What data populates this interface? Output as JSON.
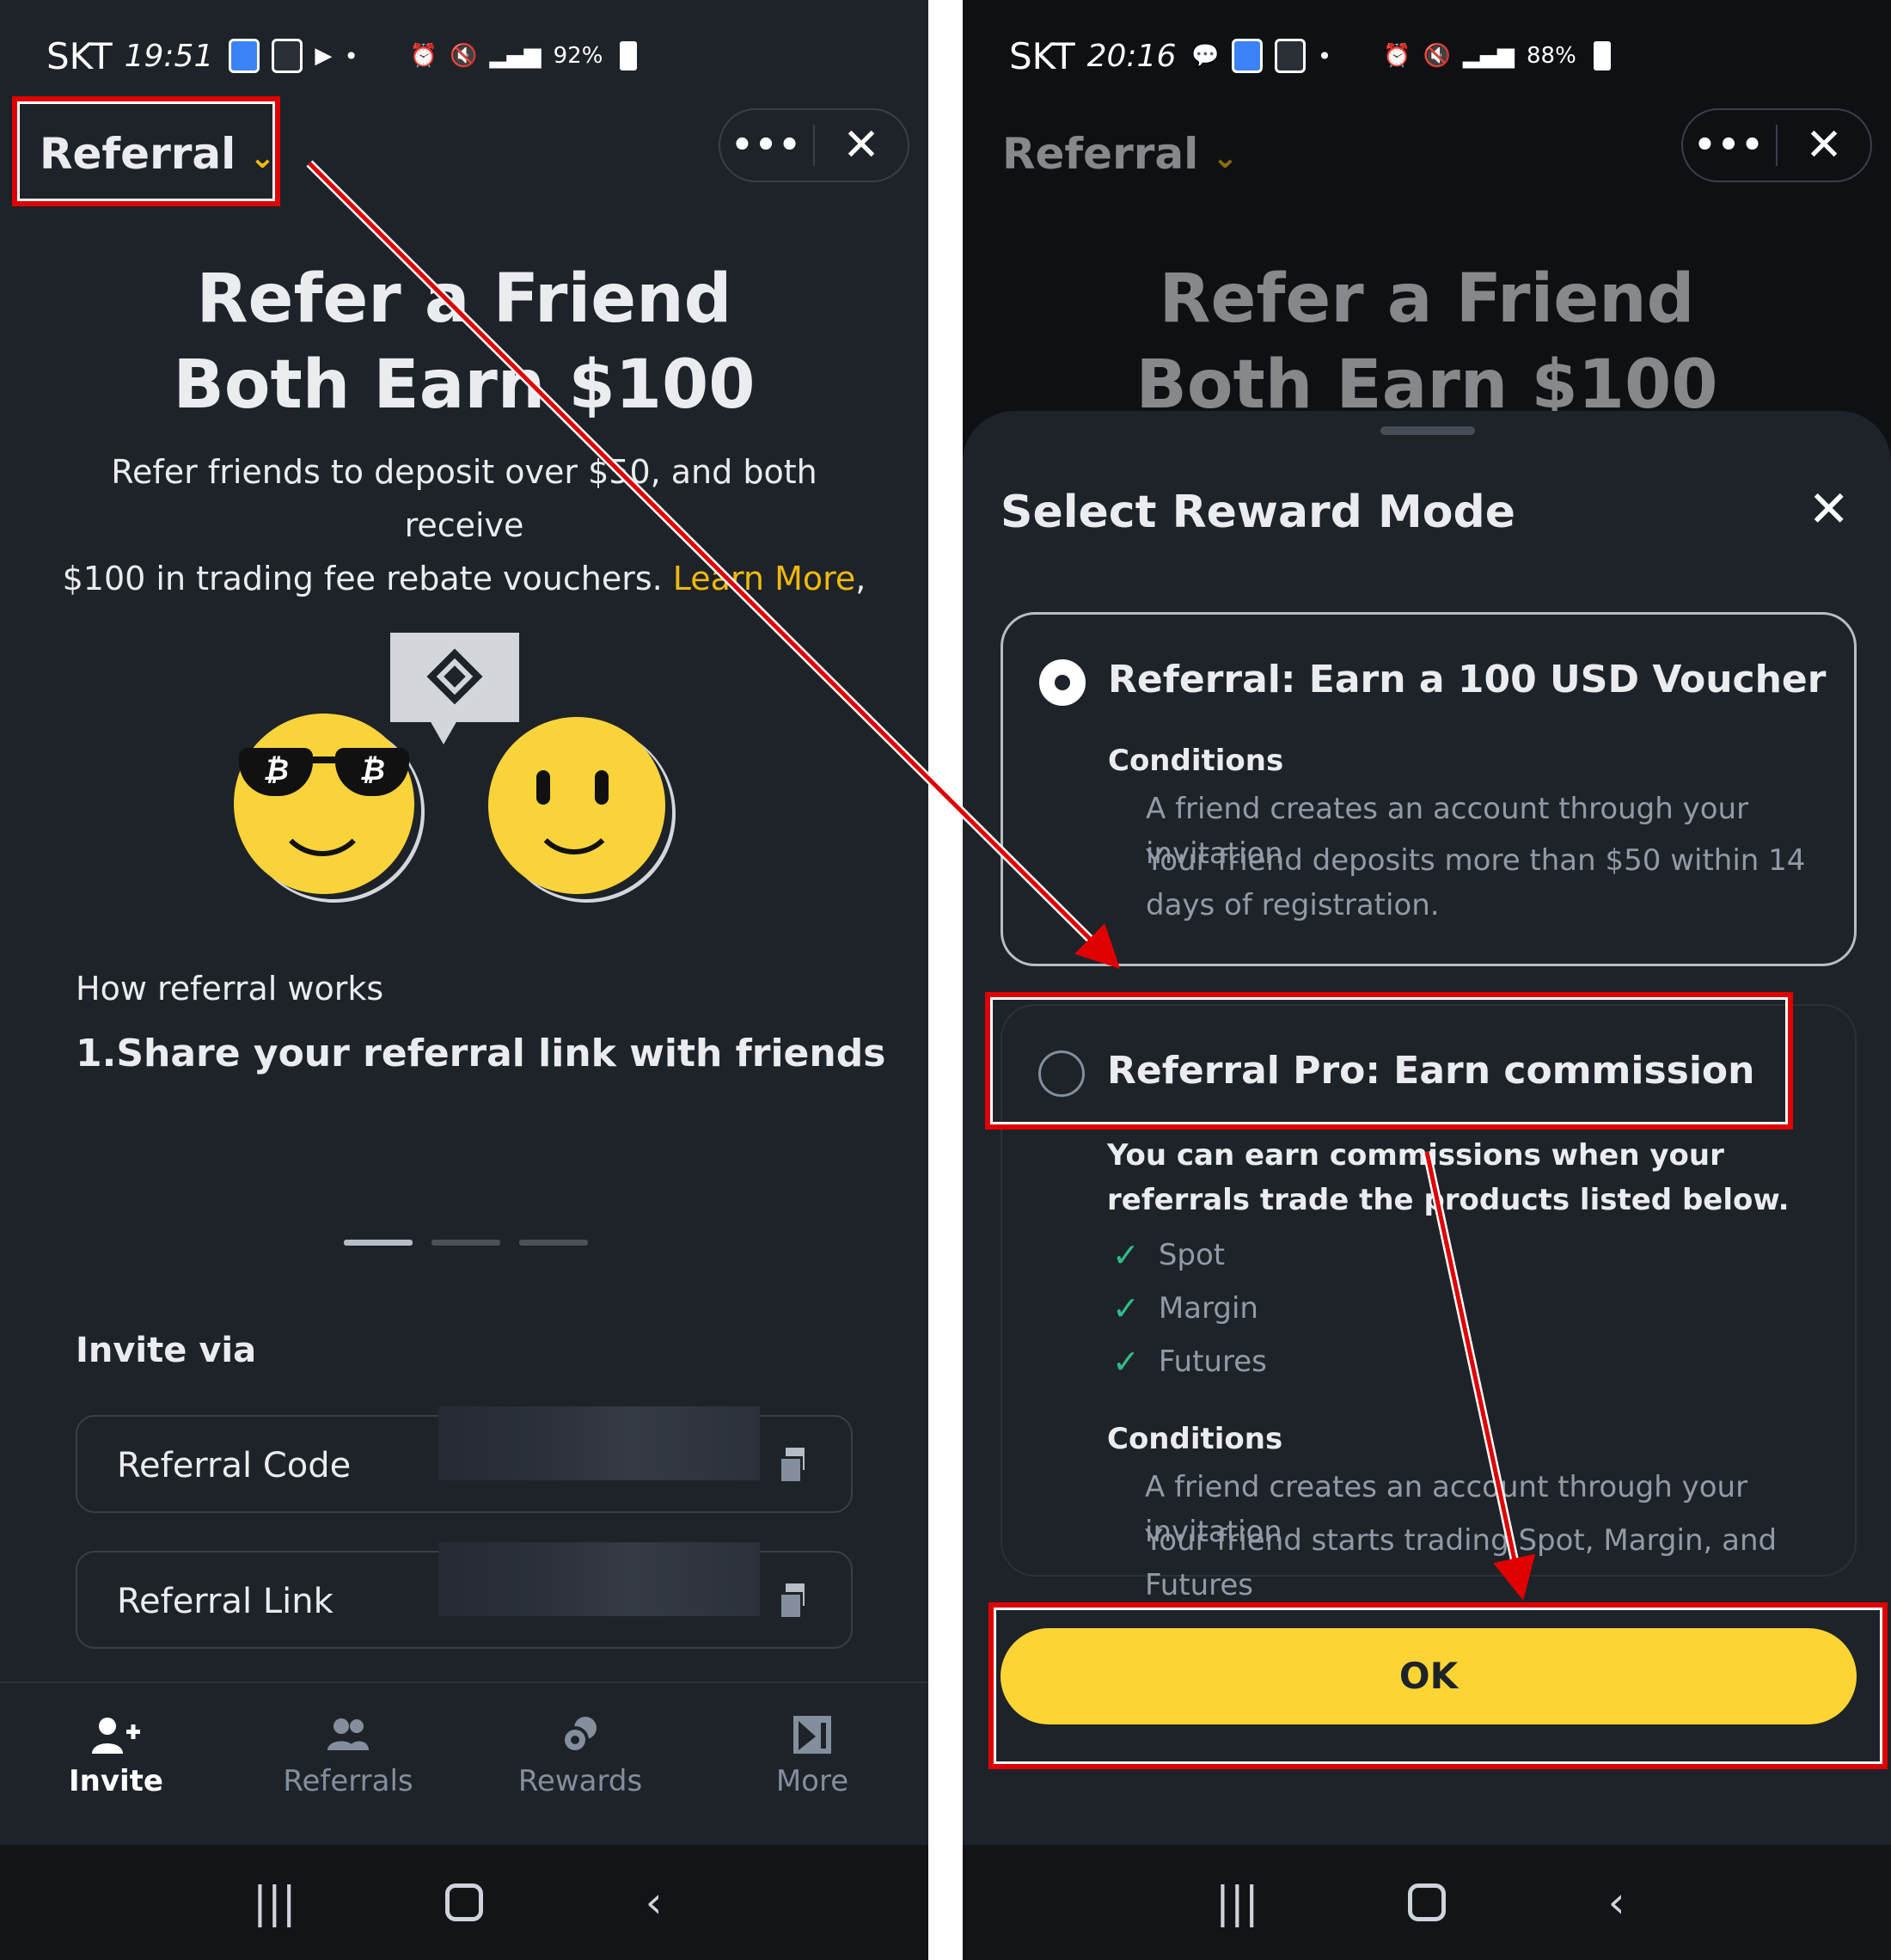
{
  "left": {
    "status": {
      "carrier": "SKT",
      "time": "19:51",
      "battery": "92%"
    },
    "nav": {
      "title": "Referral",
      "more": "•••",
      "close": "✕"
    },
    "hero": {
      "title_line1": "Refer a Friend",
      "title_line2": "Both Earn $100",
      "sub_line1": "Refer friends to deposit over $50, and both receive",
      "sub_line2": "$100 in trading fee rebate vouchers. ",
      "learn_more": "Learn More",
      "comma": ","
    },
    "glasses": {
      "left": "₿",
      "right": "₿"
    },
    "how": {
      "label": "How referral works",
      "step": "1.Share your referral link with friends"
    },
    "invite": {
      "title": "Invite via",
      "code_label": "Referral Code",
      "link_label": "Referral Link"
    },
    "bottom_nav": [
      {
        "label": "Invite",
        "icon": "add-user-icon",
        "active": true
      },
      {
        "label": "Referrals",
        "icon": "users-icon",
        "active": false
      },
      {
        "label": "Rewards",
        "icon": "coins-icon",
        "active": false
      },
      {
        "label": "More",
        "icon": "more-icon",
        "active": false
      }
    ],
    "system_nav": {
      "recents": "|||",
      "back": "‹"
    }
  },
  "right": {
    "status": {
      "carrier": "SKT",
      "time": "20:16",
      "battery": "88%"
    },
    "nav": {
      "title": "Referral",
      "more": "•••",
      "close": "✕"
    },
    "hero": {
      "title_line1": "Refer a Friend",
      "title_line2": "Both Earn $100"
    },
    "sheet": {
      "title": "Select Reward Mode",
      "close": "✕",
      "option1": {
        "title": "Referral: Earn a 100 USD Voucher",
        "conditions_header": "Conditions",
        "condition1": "A friend creates an account through your invitation",
        "condition2": "Your friend deposits more than $50 within 14 days of registration."
      },
      "option2": {
        "title": "Referral Pro: Earn commission",
        "description": "You can earn commissions when your referrals trade the products listed below.",
        "products": [
          "Spot",
          "Margin",
          "Futures"
        ],
        "check": "✓",
        "conditions_header": "Conditions",
        "condition1": "A friend creates an account through your invitation",
        "condition2": "Your friend starts trading Spot, Margin, and Futures"
      },
      "ok": "OK"
    },
    "system_nav": {
      "recents": "|||",
      "back": "‹"
    }
  },
  "colors": {
    "accent": "#f0b90b",
    "button": "#fcd535",
    "annotation": "#e00000",
    "check": "#2ebd85"
  }
}
